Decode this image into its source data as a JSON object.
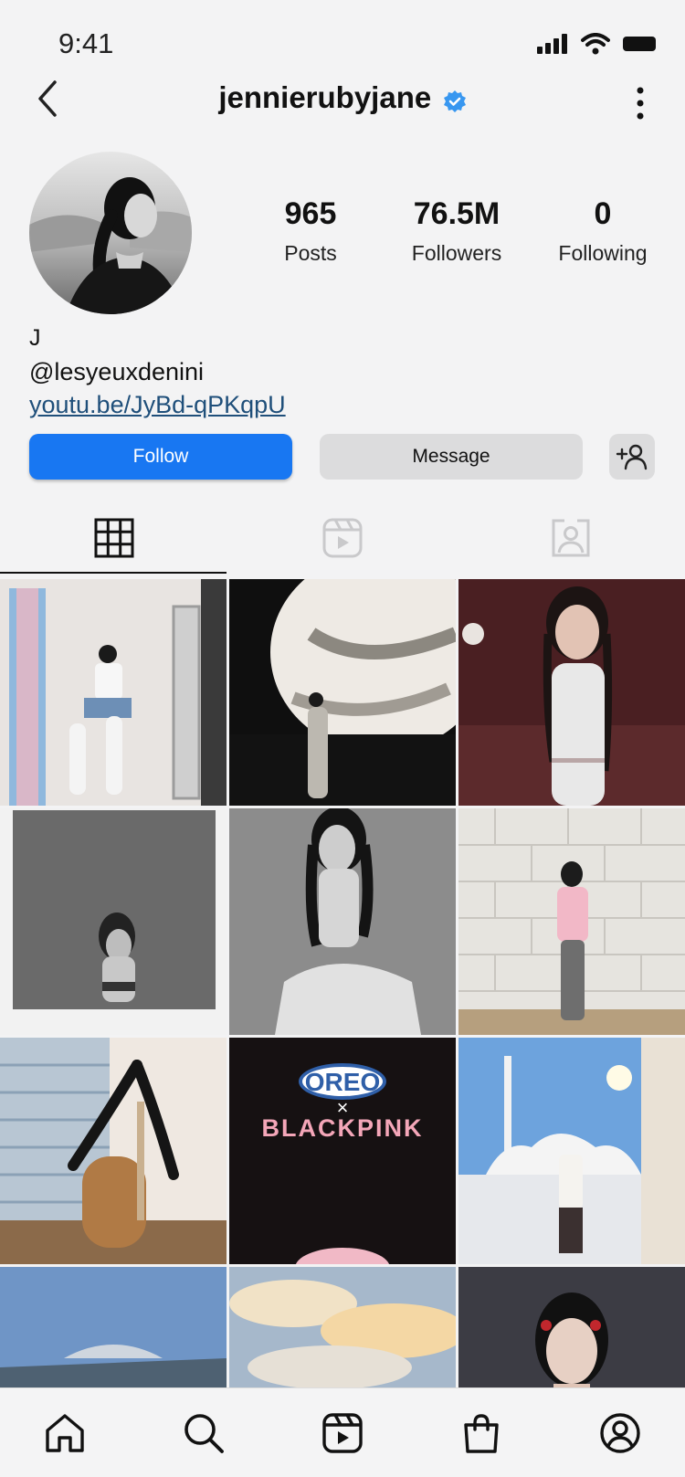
{
  "status_bar": {
    "time": "9:41"
  },
  "header": {
    "username": "jennierubyjane"
  },
  "profile": {
    "stats": [
      {
        "value": "965",
        "label": "Posts"
      },
      {
        "value": "76.5M",
        "label": "Followers"
      },
      {
        "value": "0",
        "label": "Following"
      }
    ],
    "bio": {
      "name": "J",
      "handle": "@lesyeuxdenini",
      "link": "youtu.be/JyBd-qPKqpU"
    }
  },
  "actions": {
    "follow": "Follow",
    "message": "Message"
  },
  "tabs": [
    {
      "icon": "grid-icon",
      "active": true
    },
    {
      "icon": "reels-icon",
      "active": false
    },
    {
      "icon": "tagged-icon",
      "active": false
    }
  ],
  "posts": {
    "oreo_post": {
      "brand": "OREO",
      "times": "×",
      "collab": "BLACKPINK"
    }
  },
  "colors": {
    "accent": "#1877f2",
    "button_grey": "#dcdcdd",
    "verified": "#3897f0"
  },
  "bottom_nav": [
    "home-icon",
    "search-icon",
    "reels-icon",
    "shop-icon",
    "profile-icon"
  ]
}
